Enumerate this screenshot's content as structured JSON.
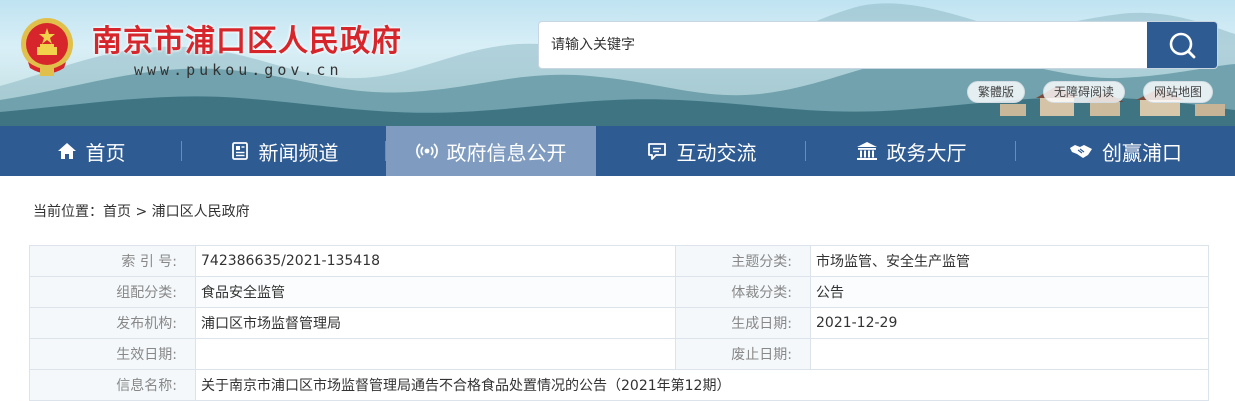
{
  "header": {
    "site_title": "南京市浦口区人民政府",
    "site_url": "www.pukou.gov.cn",
    "search": {
      "placeholder": "请输入关键字"
    },
    "top_links": [
      "繁體版",
      "无障碍阅读",
      "网站地图"
    ]
  },
  "nav": {
    "items": [
      {
        "label": "首页",
        "icon": "home-icon"
      },
      {
        "label": "新闻频道",
        "icon": "newspaper-icon"
      },
      {
        "label": "政府信息公开",
        "icon": "broadcast-icon",
        "active": true
      },
      {
        "label": "互动交流",
        "icon": "chat-icon"
      },
      {
        "label": "政务大厅",
        "icon": "government-building-icon"
      },
      {
        "label": "创赢浦口",
        "icon": "handshake-icon"
      }
    ],
    "active_color": "#7f9cc0",
    "bar_color": "#2f5b93"
  },
  "breadcrumb": {
    "prefix": "当前位置：",
    "items": [
      "首页",
      "浦口区人民政府"
    ],
    "separator": " > "
  },
  "info": {
    "index_no_label": "索 引 号:",
    "index_no": "742386635/2021-135418",
    "topic_label": "主题分类:",
    "topic": "市场监管、安全生产监管",
    "group_label": "组配分类:",
    "group": "食品安全监管",
    "genre_label": "体裁分类:",
    "genre": "公告",
    "publisher_label": "发布机构:",
    "publisher": "浦口区市场监督管理局",
    "created_label": "生成日期:",
    "created": "2021-12-29",
    "effective_label": "生效日期:",
    "effective": "",
    "expiry_label": "废止日期:",
    "expiry": "",
    "name_label": "信息名称:",
    "name": "关于南京市浦口区市场监督管理局通告不合格食品处置情况的公告（2021年第12期）"
  }
}
